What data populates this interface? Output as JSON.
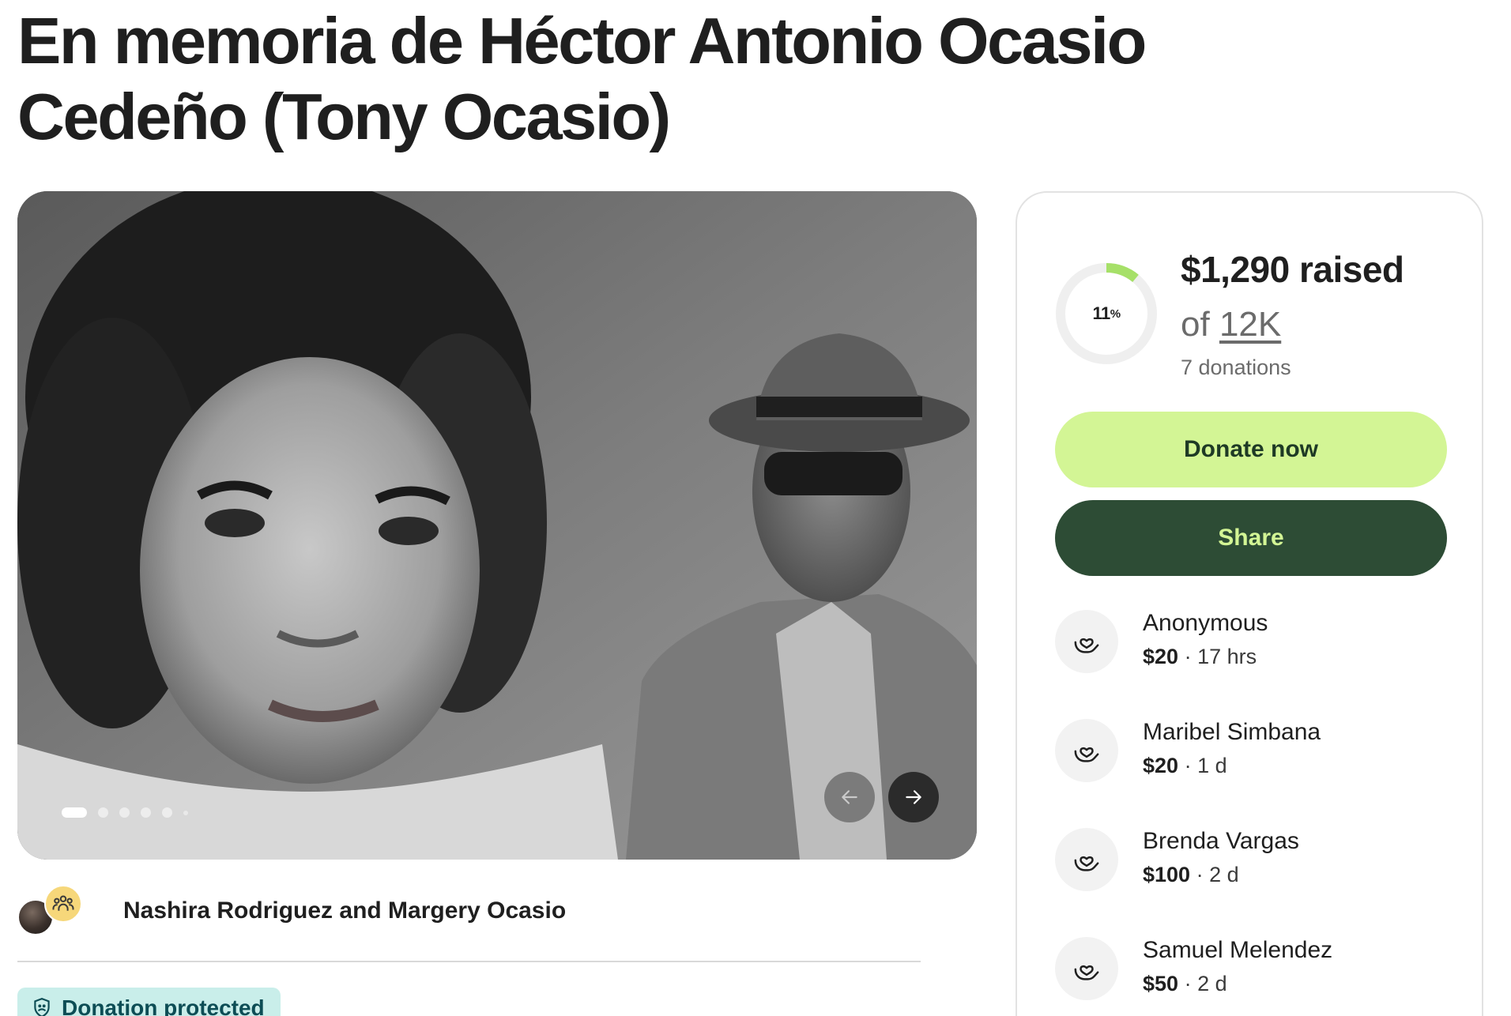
{
  "page": {
    "title": "En memoria de Héctor Antonio Ocasio Cedeño (Tony Ocasio)"
  },
  "carousel": {
    "slide_count": 5,
    "active_slide": 1,
    "prev_icon": "arrow-left-icon",
    "next_icon": "arrow-right-icon"
  },
  "organizers": {
    "names": "Nashira Rodriguez and Margery Ocasio",
    "group_icon": "people-group-icon"
  },
  "badge": {
    "label": "Donation protected",
    "icon": "shield-icon"
  },
  "fundraiser": {
    "progress_percent": 11,
    "progress_label": "11",
    "progress_unit": "%",
    "raised_label": "$1,290 raised",
    "goal_prefix": "of",
    "goal_amount": "12K",
    "donations_label": "7 donations",
    "accent_color": "#a6e068",
    "track_color": "#efefef"
  },
  "actions": {
    "donate_label": "Donate now",
    "share_label": "Share"
  },
  "donations": [
    {
      "name": "Anonymous",
      "amount": "$20",
      "time": "17 hrs"
    },
    {
      "name": "Maribel Simbana",
      "amount": "$20",
      "time": "1 d"
    },
    {
      "name": "Brenda Vargas",
      "amount": "$100",
      "time": "2 d"
    },
    {
      "name": "Samuel Melendez",
      "amount": "$50",
      "time": "2 d"
    }
  ]
}
